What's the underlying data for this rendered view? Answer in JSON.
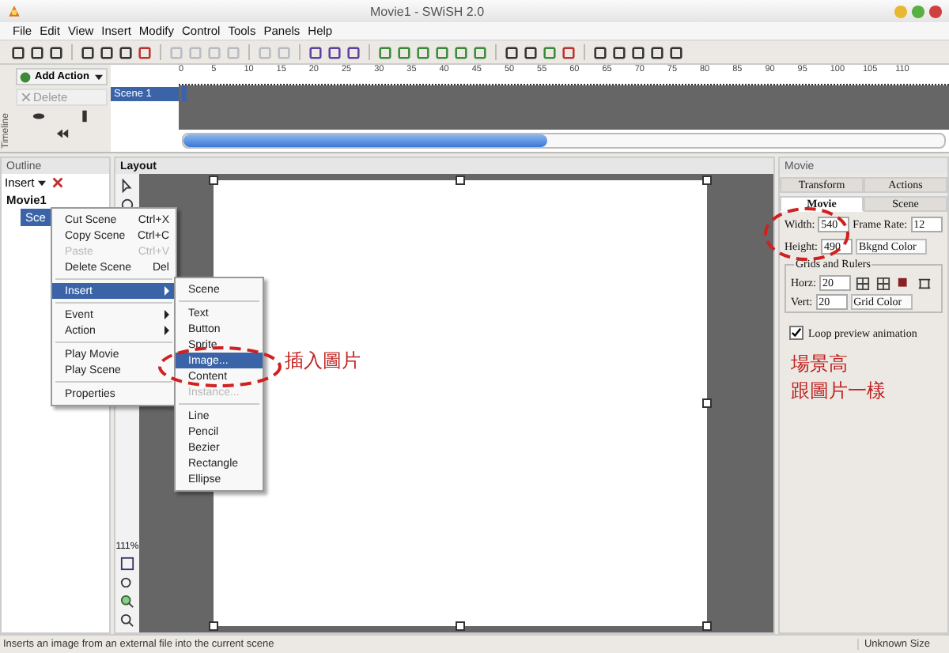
{
  "window": {
    "title": "Movie1 - SWiSH 2.0"
  },
  "menu_bar": [
    "File",
    "Edit",
    "View",
    "Insert",
    "Modify",
    "Control",
    "Tools",
    "Panels",
    "Help"
  ],
  "timeline": {
    "label": "Timeline",
    "add_action": "Add Action",
    "delete": "Delete",
    "scenes": [
      {
        "label": "Scene 1",
        "selected": true
      }
    ],
    "ruler": [
      "0",
      "5",
      "10",
      "15",
      "20",
      "25",
      "30",
      "35",
      "40",
      "45",
      "50",
      "55",
      "60",
      "65",
      "70",
      "75",
      "80",
      "85",
      "90",
      "95",
      "100",
      "105",
      "110"
    ]
  },
  "outline": {
    "title": "Outline",
    "insert": "Insert",
    "tree": [
      {
        "label": "Movie1",
        "selected": false,
        "children": [
          {
            "label": "Sce",
            "selected": true
          }
        ]
      }
    ]
  },
  "context_menu": {
    "groups": [
      [
        {
          "label": "Cut Scene",
          "shortcut": "Ctrl+X",
          "selected": false,
          "disabled": false,
          "submenu": false
        },
        {
          "label": "Copy Scene",
          "shortcut": "Ctrl+C",
          "selected": false,
          "disabled": false,
          "submenu": false
        },
        {
          "label": "Paste",
          "shortcut": "Ctrl+V",
          "selected": false,
          "disabled": true,
          "submenu": false
        },
        {
          "label": "Delete Scene",
          "shortcut": "Del",
          "selected": false,
          "disabled": false,
          "submenu": false
        }
      ],
      [
        {
          "label": "Insert",
          "selected": true,
          "disabled": false,
          "submenu": true
        }
      ],
      [
        {
          "label": "Event",
          "selected": false,
          "disabled": false,
          "submenu": true
        },
        {
          "label": "Action",
          "selected": false,
          "disabled": false,
          "submenu": true
        }
      ],
      [
        {
          "label": "Play Movie",
          "selected": false,
          "disabled": false,
          "submenu": false
        },
        {
          "label": "Play Scene",
          "selected": false,
          "disabled": false,
          "submenu": false
        }
      ],
      [
        {
          "label": "Properties",
          "selected": false,
          "disabled": false,
          "submenu": false
        }
      ]
    ]
  },
  "submenu": {
    "groups": [
      [
        {
          "label": "Scene",
          "selected": false,
          "disabled": false,
          "submenu": false
        }
      ],
      [
        {
          "label": "Text",
          "selected": false,
          "disabled": false,
          "submenu": false
        },
        {
          "label": "Button",
          "selected": false,
          "disabled": false,
          "submenu": false
        },
        {
          "label": "Sprite",
          "selected": false,
          "disabled": false,
          "submenu": false
        },
        {
          "label": "Image...",
          "selected": true,
          "disabled": false,
          "submenu": false
        },
        {
          "label": "Content",
          "selected": false,
          "disabled": false,
          "submenu": false
        },
        {
          "label": "Instance...",
          "selected": false,
          "disabled": true,
          "submenu": false
        }
      ],
      [
        {
          "label": "Line",
          "selected": false,
          "disabled": false,
          "submenu": false
        },
        {
          "label": "Pencil",
          "selected": false,
          "disabled": false,
          "submenu": false
        },
        {
          "label": "Bezier",
          "selected": false,
          "disabled": false,
          "submenu": false
        },
        {
          "label": "Rectangle",
          "selected": false,
          "disabled": false,
          "submenu": false
        },
        {
          "label": "Ellipse",
          "selected": false,
          "disabled": false,
          "submenu": false
        }
      ]
    ]
  },
  "layout": {
    "title": "Layout",
    "zoom": "111%"
  },
  "movie_panel": {
    "title": "Movie",
    "tabs": [
      [
        {
          "label": "Transform",
          "selected": false
        },
        {
          "label": "Actions",
          "selected": false
        }
      ],
      [
        {
          "label": "Movie",
          "selected": true
        },
        {
          "label": "Scene",
          "selected": false
        }
      ]
    ],
    "width": {
      "label": "Width:",
      "value": "540"
    },
    "frame_rate": {
      "label": "Frame Rate:",
      "value": "12"
    },
    "height": {
      "label": "Height:",
      "value": "490"
    },
    "bkgnd_color": {
      "label": "Bkgnd Color"
    },
    "grids": {
      "title": "Grids and Rulers",
      "horz": {
        "label": "Horz:",
        "value": "20"
      },
      "vert": {
        "label": "Vert:",
        "value": "20"
      },
      "grid_color": {
        "label": "Grid Color"
      }
    },
    "loop": {
      "label": "Loop preview animation",
      "checked": true
    }
  },
  "annotations": [
    {
      "lines": [
        "插入圖片"
      ]
    },
    {
      "lines": [
        "場景高",
        "跟圖片一樣"
      ]
    }
  ],
  "status_bar": {
    "message": "Inserts an image from an external file into the current scene",
    "size": "Unknown Size"
  }
}
